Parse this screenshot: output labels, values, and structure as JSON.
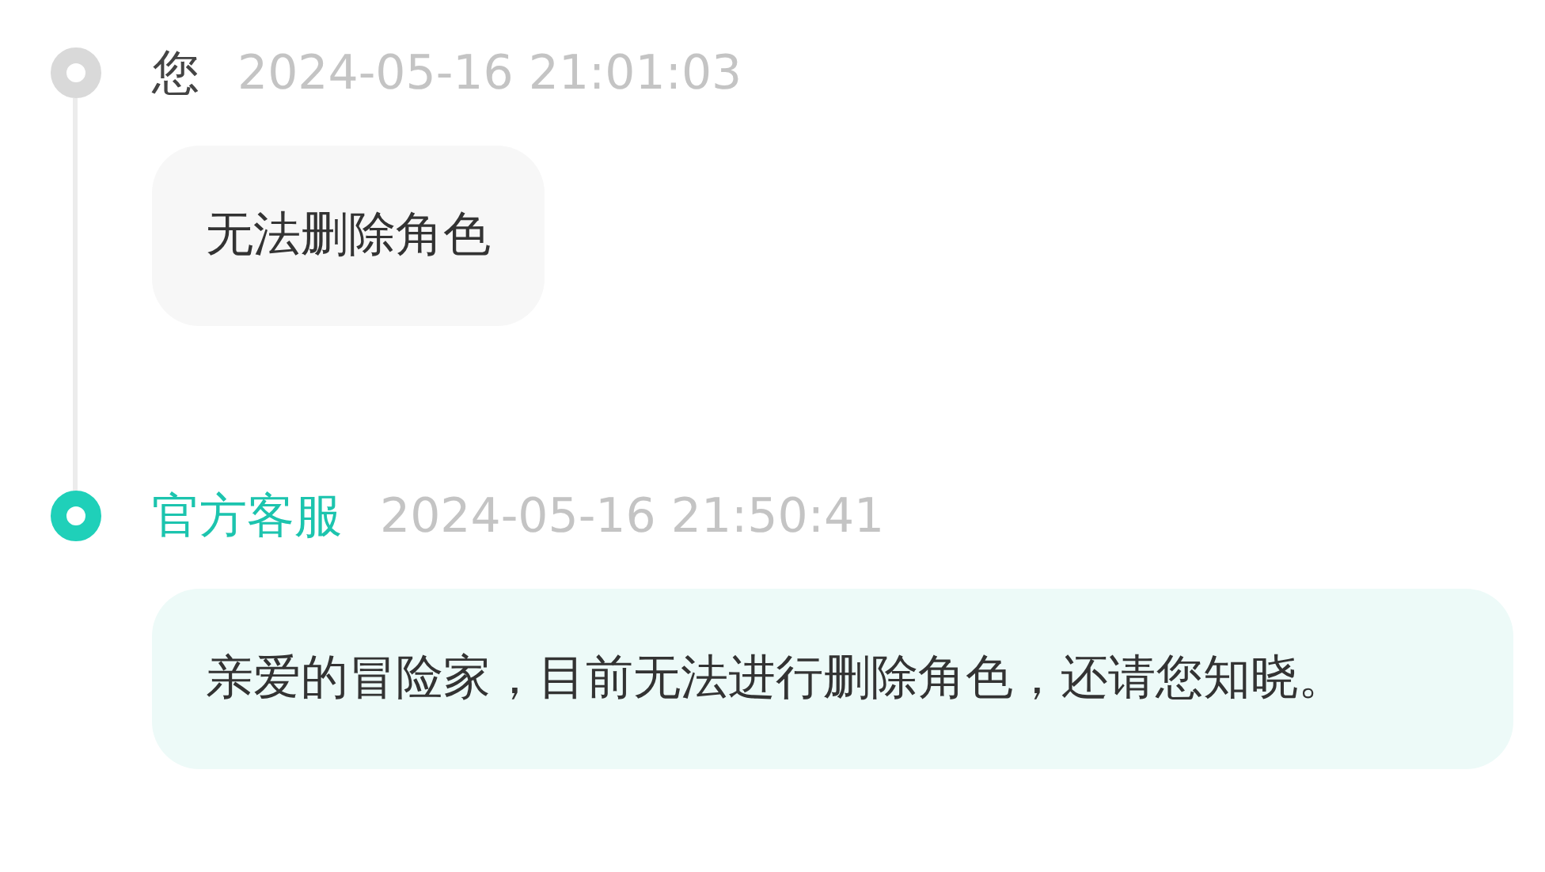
{
  "messages": [
    {
      "kind": "user",
      "sender": "您",
      "time": "2024-05-16 21:01:03",
      "text": "无法删除角色"
    },
    {
      "kind": "official",
      "sender": "官方客服",
      "time": "2024-05-16 21:50:41",
      "text": "亲爱的冒险家，目前无法进行删除角色，还请您知晓。"
    }
  ]
}
